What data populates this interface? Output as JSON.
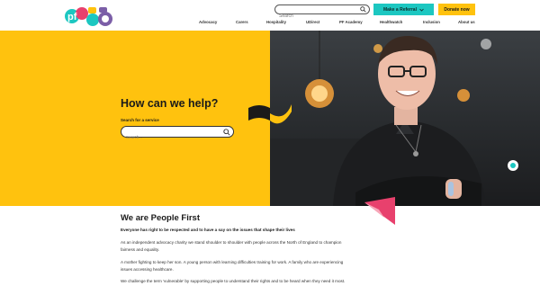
{
  "header": {
    "search_placeholder": "Search",
    "referral_label": "Make a Referral",
    "donate_label": "Donate now",
    "nav": [
      "Advocacy",
      "Carers",
      "Hospitality",
      "UDirect",
      "PF Academy",
      "Healthwatch",
      "Inclusion",
      "About us"
    ]
  },
  "hero": {
    "title": "How can we help?",
    "search_label": "Search for a service",
    "search_placeholder": "Search..."
  },
  "content": {
    "title": "We are People First",
    "subtitle": "Everyone has right to be respected and to have a say on the issues that shape their lives",
    "paragraphs": [
      "As an independent advocacy charity we stand shoulder to shoulder with people across the North of England to champion fairness and equality.",
      "A mother fighting to keep her son. A young person with learning difficulties training for work. A family who are experiencing issues accessing healthcare.",
      "We challenge the term 'vulnerable' by supporting people to understand their rights and to be heard when they need it most."
    ]
  },
  "colors": {
    "yellow": "#ffc20e",
    "teal": "#1cc7c1",
    "pink": "#e8416d",
    "purple": "#7b5ea7"
  },
  "icons": [
    "logo-pf55",
    "search-icon",
    "chevron-down-icon"
  ]
}
